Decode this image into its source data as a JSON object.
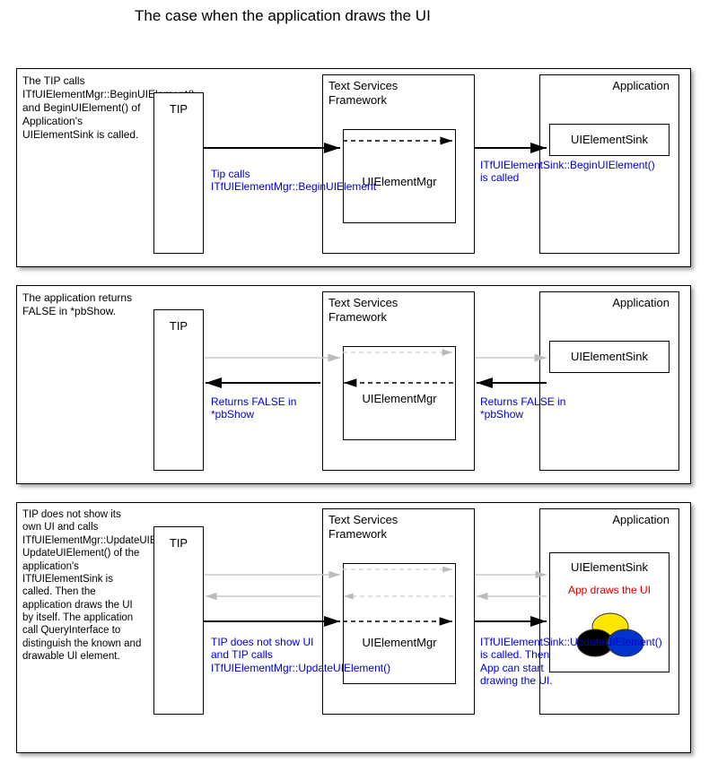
{
  "title": "The case when the application draws the UI",
  "labels": {
    "tip": "TIP",
    "tsf": "Text Services\nFramework",
    "uimgr": "UIElementMgr",
    "app": "Application",
    "sink": "UIElementSink"
  },
  "panels": [
    {
      "desc": "The TIP calls ITfUIElementMgr::BeginUIElement() and BeginUIElement() of Application's UIElementSink is called.",
      "caption_left": "Tip calls ITfUIElementMgr::BeginUIElement",
      "caption_right": "ITfUIElementSink::BeginUIElement() is called"
    },
    {
      "desc": "The application returns FALSE in *pbShow.",
      "caption_left": "Returns FALSE in *pbShow",
      "caption_right": "Returns FALSE in *pbShow"
    },
    {
      "desc": "TIP does not show its own UI and calls ITfUIElementMgr::UpdateUIElement(). UpdateUIElement() of the application's ITfUIElementSink is called. Then the application draws the UI by itself. The application call QueryInterface to distinguish the known and drawable UI element.",
      "caption_left": "TIP does not show UI and TIP calls ITfUIElementMgr::UpdateUIElement()",
      "caption_right": "ITfUIElementSink::UpdateUIElement() is called. Then App can start drawing the UI.",
      "app_draws": "App draws the UI"
    }
  ]
}
